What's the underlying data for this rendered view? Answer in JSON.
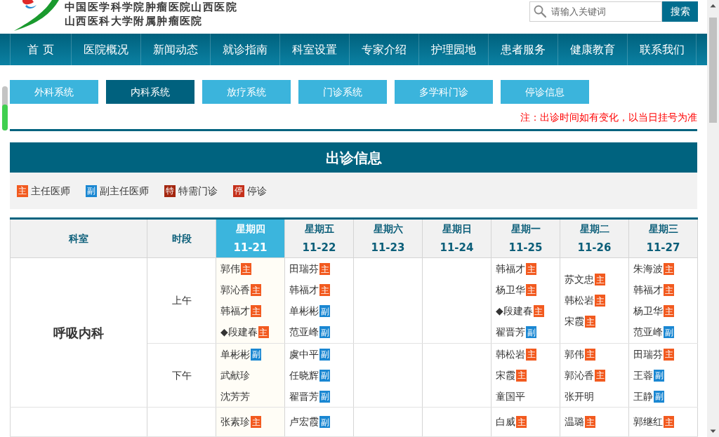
{
  "header": {
    "name_lines": [
      "中国医学科学院肿瘤医院山西医院",
      "山西医科大学附属肿瘤医院"
    ],
    "search": {
      "placeholder": "请输入关键词",
      "button": "搜索"
    }
  },
  "nav": [
    "首 页",
    "医院概况",
    "新闻动态",
    "就诊指南",
    "科室设置",
    "专家介绍",
    "护理园地",
    "患者服务",
    "健康教育",
    "联系我们"
  ],
  "system_tabs": [
    {
      "label": "外科系统",
      "selected": false
    },
    {
      "label": "内科系统",
      "selected": true
    },
    {
      "label": "放疗系统",
      "selected": false
    },
    {
      "label": "门诊系统",
      "selected": false
    },
    {
      "label": "多学科门诊",
      "selected": false
    },
    {
      "label": "停诊信息",
      "selected": false
    }
  ],
  "notice": "注：出诊时间如有变化，以当日挂号为准",
  "schedule": {
    "title": "出诊信息",
    "legend": [
      {
        "badge": "主",
        "label": "主任医师",
        "color": "#f25a1f"
      },
      {
        "badge": "副",
        "label": "副主任医师",
        "color": "#1a87d2"
      },
      {
        "badge": "特",
        "label": "特需门诊",
        "color": "#a3260f"
      },
      {
        "badge": "停",
        "label": "停诊",
        "color": "#c5301b"
      }
    ],
    "columns": [
      "科室",
      "时段"
    ],
    "days": [
      {
        "weekday": "星期四",
        "date": "11-21",
        "selected": true
      },
      {
        "weekday": "星期五",
        "date": "11-22",
        "selected": false
      },
      {
        "weekday": "星期六",
        "date": "11-23",
        "selected": false
      },
      {
        "weekday": "星期日",
        "date": "11-24",
        "selected": false
      },
      {
        "weekday": "星期一",
        "date": "11-25",
        "selected": false
      },
      {
        "weekday": "星期二",
        "date": "11-26",
        "selected": false
      },
      {
        "weekday": "星期三",
        "date": "11-27",
        "selected": false
      }
    ],
    "departments": [
      {
        "name": "呼吸内科",
        "sessions": [
          {
            "label": "上午",
            "slots": [
              {
                "kind": "roster",
                "doctors": [
                  {
                    "name": "郭伟",
                    "badge": {
                      "text": "主",
                      "color": "#f25a1f"
                    }
                  },
                  {
                    "name": "郭沁香",
                    "badge": {
                      "text": "主",
                      "color": "#f25a1f"
                    }
                  },
                  {
                    "name": "韩福才",
                    "badge": {
                      "text": "主",
                      "color": "#f25a1f"
                    }
                  },
                  {
                    "name": "◆段建春",
                    "badge": {
                      "text": "主",
                      "color": "#f25a1f"
                    }
                  }
                ]
              },
              {
                "kind": "roster",
                "doctors": [
                  {
                    "name": "田瑞芬",
                    "badge": {
                      "text": "主",
                      "color": "#f25a1f"
                    }
                  },
                  {
                    "name": "韩福才",
                    "badge": {
                      "text": "主",
                      "color": "#f25a1f"
                    }
                  },
                  {
                    "name": "单彬彬",
                    "badge": {
                      "text": "副",
                      "color": "#1a87d2"
                    }
                  },
                  {
                    "name": "范亚峰",
                    "badge": {
                      "text": "副",
                      "color": "#1a87d2"
                    }
                  }
                ]
              },
              {
                "kind": "blank"
              },
              {
                "kind": "blank"
              },
              {
                "kind": "roster",
                "doctors": [
                  {
                    "name": "韩福才",
                    "badge": {
                      "text": "主",
                      "color": "#f25a1f"
                    }
                  },
                  {
                    "name": "杨卫华",
                    "badge": {
                      "text": "主",
                      "color": "#f25a1f"
                    }
                  },
                  {
                    "name": "◆段建春",
                    "badge": {
                      "text": "主",
                      "color": "#f25a1f"
                    }
                  },
                  {
                    "name": "翟晋芳",
                    "badge": {
                      "text": "副",
                      "color": "#1a87d2"
                    }
                  }
                ]
              },
              {
                "kind": "roster",
                "doctors": [
                  {
                    "name": "苏文忠",
                    "badge": {
                      "text": "主",
                      "color": "#f25a1f"
                    }
                  },
                  {
                    "name": "韩松岩",
                    "badge": {
                      "text": "主",
                      "color": "#f25a1f"
                    }
                  },
                  {
                    "name": "宋霞",
                    "badge": {
                      "text": "主",
                      "color": "#f25a1f"
                    }
                  }
                ]
              },
              {
                "kind": "roster",
                "doctors": [
                  {
                    "name": "朱海波",
                    "badge": {
                      "text": "主",
                      "color": "#f25a1f"
                    }
                  },
                  {
                    "name": "韩福才",
                    "badge": {
                      "text": "主",
                      "color": "#f25a1f"
                    }
                  },
                  {
                    "name": "杨卫华",
                    "badge": {
                      "text": "主",
                      "color": "#f25a1f"
                    }
                  },
                  {
                    "name": "范亚峰",
                    "badge": {
                      "text": "副",
                      "color": "#1a87d2"
                    }
                  }
                ]
              }
            ]
          },
          {
            "label": "下午",
            "slots": [
              {
                "kind": "roster",
                "doctors": [
                  {
                    "name": "单彬彬",
                    "badge": {
                      "text": "副",
                      "color": "#1a87d2"
                    }
                  },
                  {
                    "name": "武献珍"
                  },
                  {
                    "name": "沈芳芳"
                  }
                ]
              },
              {
                "kind": "roster",
                "doctors": [
                  {
                    "name": "虞中平",
                    "badge": {
                      "text": "副",
                      "color": "#1a87d2"
                    }
                  },
                  {
                    "name": "任晓辉",
                    "badge": {
                      "text": "副",
                      "color": "#1a87d2"
                    }
                  },
                  {
                    "name": "翟晋芳",
                    "badge": {
                      "text": "副",
                      "color": "#1a87d2"
                    }
                  }
                ]
              },
              {
                "kind": "blank"
              },
              {
                "kind": "blank"
              },
              {
                "kind": "roster",
                "doctors": [
                  {
                    "name": "韩松岩",
                    "badge": {
                      "text": "主",
                      "color": "#f25a1f"
                    }
                  },
                  {
                    "name": "宋霞",
                    "badge": {
                      "text": "主",
                      "color": "#f25a1f"
                    }
                  },
                  {
                    "name": "童国平"
                  }
                ]
              },
              {
                "kind": "roster",
                "doctors": [
                  {
                    "name": "郭伟",
                    "badge": {
                      "text": "主",
                      "color": "#f25a1f"
                    }
                  },
                  {
                    "name": "郭沁香",
                    "badge": {
                      "text": "主",
                      "color": "#f25a1f"
                    }
                  },
                  {
                    "name": "张开明"
                  }
                ]
              },
              {
                "kind": "roster",
                "doctors": [
                  {
                    "name": "田瑞芬",
                    "badge": {
                      "text": "主",
                      "color": "#f25a1f"
                    }
                  },
                  {
                    "name": "王蓉",
                    "badge": {
                      "text": "副",
                      "color": "#1a87d2"
                    }
                  },
                  {
                    "name": "王静",
                    "badge": {
                      "text": "副",
                      "color": "#1a87d2"
                    }
                  }
                ]
              }
            ]
          }
        ]
      },
      {
        "sessions": [
          {
            "slots": [
              {
                "kind": "roster",
                "doctors": [
                  {
                    "name": "张素珍",
                    "badge": {
                      "text": "主",
                      "color": "#f25a1f"
                    }
                  }
                ]
              },
              {
                "kind": "roster",
                "doctors": [
                  {
                    "name": "卢宏霞",
                    "badge": {
                      "text": "副",
                      "color": "#1a87d2"
                    }
                  }
                ]
              },
              {
                "kind": "blank"
              },
              {
                "kind": "blank"
              },
              {
                "kind": "roster",
                "doctors": [
                  {
                    "name": "白威",
                    "badge": {
                      "text": "主",
                      "color": "#f25a1f"
                    }
                  }
                ]
              },
              {
                "kind": "roster",
                "doctors": [
                  {
                    "name": "温璐",
                    "badge": {
                      "text": "主",
                      "color": "#f25a1f"
                    }
                  }
                ]
              },
              {
                "kind": "roster",
                "doctors": [
                  {
                    "name": "郭继红",
                    "badge": {
                      "text": "主",
                      "color": "#f25a1f"
                    }
                  }
                ]
              }
            ]
          }
        ]
      }
    ]
  }
}
